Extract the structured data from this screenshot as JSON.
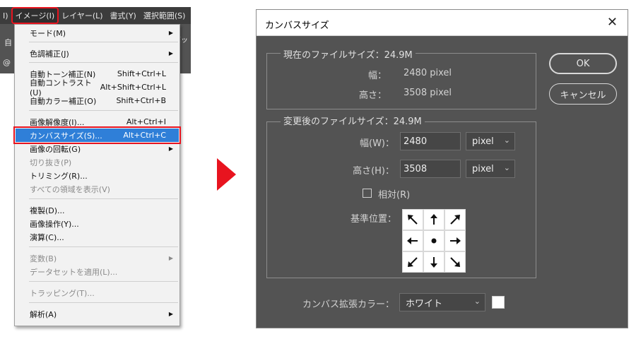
{
  "menubar": {
    "items": [
      "I)",
      "イメージ(I)",
      "レイヤー(L)",
      "書式(Y)",
      "選択範囲(S)"
    ],
    "active_index": 1
  },
  "app_fragments": {
    "left": "自",
    "right": "ボッ",
    "at": "@"
  },
  "image_menu": {
    "items": [
      {
        "label": "モード(M)",
        "shortcut": "",
        "submenu": true,
        "disabled": false
      },
      {
        "label": "色調補正(J)",
        "shortcut": "",
        "submenu": true,
        "disabled": false
      },
      {
        "label": "自動トーン補正(N)",
        "shortcut": "Shift+Ctrl+L",
        "submenu": false,
        "disabled": false
      },
      {
        "label": "自動コントラスト(U)",
        "shortcut": "Alt+Shift+Ctrl+L",
        "submenu": false,
        "disabled": false
      },
      {
        "label": "自動カラー補正(O)",
        "shortcut": "Shift+Ctrl+B",
        "submenu": false,
        "disabled": false
      },
      {
        "label": "画像解像度(I)...",
        "shortcut": "Alt+Ctrl+I",
        "submenu": false,
        "disabled": false
      },
      {
        "label": "カンバスサイズ(S)...",
        "shortcut": "Alt+Ctrl+C",
        "submenu": false,
        "disabled": false,
        "highlighted": true
      },
      {
        "label": "画像の回転(G)",
        "shortcut": "",
        "submenu": true,
        "disabled": false
      },
      {
        "label": "切り抜き(P)",
        "shortcut": "",
        "submenu": false,
        "disabled": true
      },
      {
        "label": "トリミング(R)...",
        "shortcut": "",
        "submenu": false,
        "disabled": false
      },
      {
        "label": "すべての領域を表示(V)",
        "shortcut": "",
        "submenu": false,
        "disabled": true
      },
      {
        "label": "複製(D)...",
        "shortcut": "",
        "submenu": false,
        "disabled": false
      },
      {
        "label": "画像操作(Y)...",
        "shortcut": "",
        "submenu": false,
        "disabled": false
      },
      {
        "label": "演算(C)...",
        "shortcut": "",
        "submenu": false,
        "disabled": false
      },
      {
        "label": "変数(B)",
        "shortcut": "",
        "submenu": true,
        "disabled": true
      },
      {
        "label": "データセットを適用(L)...",
        "shortcut": "",
        "submenu": false,
        "disabled": true
      },
      {
        "label": "トラッピング(T)...",
        "shortcut": "",
        "submenu": false,
        "disabled": true
      },
      {
        "label": "解析(A)",
        "shortcut": "",
        "submenu": true,
        "disabled": false
      }
    ]
  },
  "dialog": {
    "title": "カンバスサイズ",
    "close_glyph": "✕",
    "current": {
      "title": "現在のファイルサイズ：24.9M",
      "width_label": "幅：",
      "width_value": "2480 pixel",
      "height_label": "高さ：",
      "height_value": "3508 pixel"
    },
    "new_size": {
      "title": "変更後のファイルサイズ：24.9M",
      "width_label": "幅(W)：",
      "width_value": "2480",
      "width_unit": "pixel",
      "height_label": "高さ(H)：",
      "height_value": "3508",
      "height_unit": "pixel",
      "relative_label": "相対(R)",
      "relative_checked": false,
      "anchor_label": "基準位置：",
      "anchor_selected": "center"
    },
    "extension_color_label": "カンバス拡張カラー：",
    "extension_color_value": "ホワイト",
    "extension_color_swatch": "#ffffff",
    "ok_label": "OK",
    "cancel_label": "キャンセル"
  },
  "colors": {
    "highlight_outline": "#e8141f",
    "menu_selection": "#2f7fd8",
    "dialog_bg": "#535353"
  }
}
